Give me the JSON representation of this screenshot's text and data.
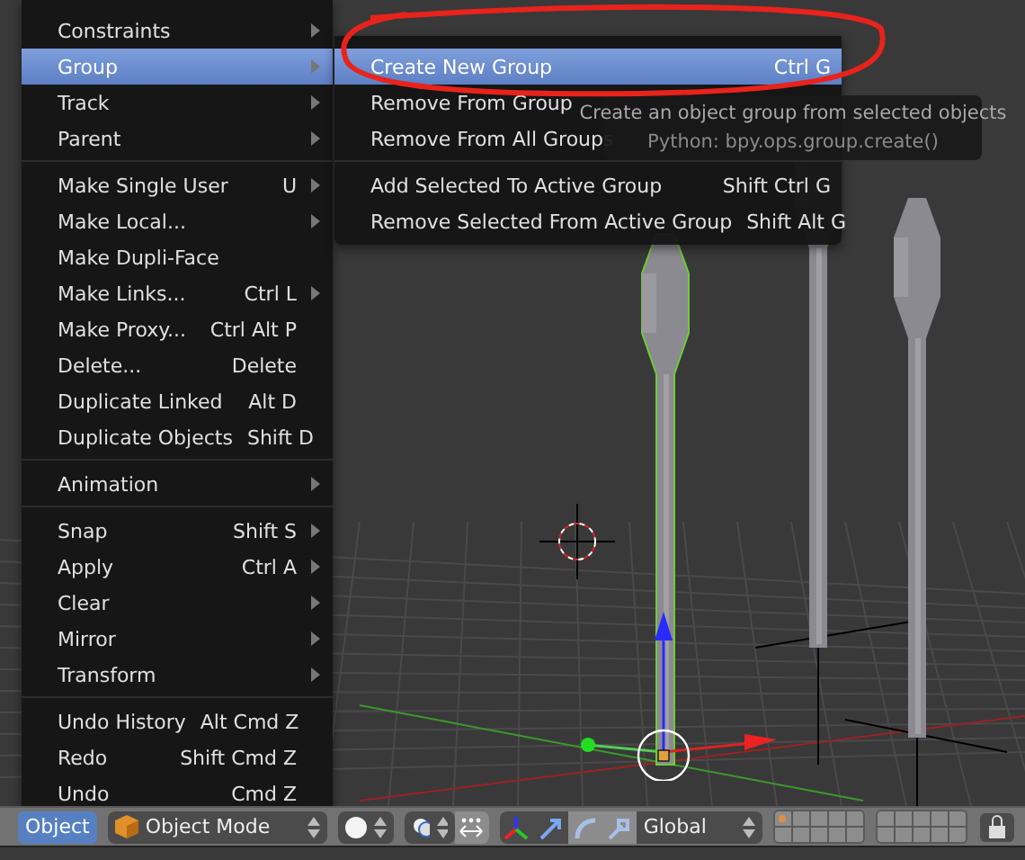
{
  "object_menu": {
    "items": [
      {
        "kind": "item",
        "label": "Constraints",
        "submenu": true,
        "selected": false
      },
      {
        "kind": "item",
        "label": "Group",
        "submenu": true,
        "selected": true
      },
      {
        "kind": "item",
        "label": "Track",
        "submenu": true,
        "selected": false
      },
      {
        "kind": "item",
        "label": "Parent",
        "submenu": true,
        "selected": false
      },
      {
        "kind": "separator"
      },
      {
        "kind": "item",
        "label": "Make Single User",
        "shortcut": "U",
        "submenu": true,
        "selected": false
      },
      {
        "kind": "item",
        "label": "Make Local...",
        "submenu": true,
        "selected": false
      },
      {
        "kind": "item",
        "label": "Make Dupli-Face",
        "submenu": false,
        "selected": false
      },
      {
        "kind": "item",
        "label": "Make Links...",
        "shortcut": "Ctrl L",
        "submenu": true,
        "selected": false
      },
      {
        "kind": "item",
        "label": "Make Proxy...",
        "shortcut": "Ctrl Alt P",
        "submenu": false,
        "selected": false
      },
      {
        "kind": "item",
        "label": "Delete...",
        "shortcut": "Delete",
        "submenu": false,
        "selected": false
      },
      {
        "kind": "item",
        "label": "Duplicate Linked",
        "shortcut": "Alt D",
        "submenu": false,
        "selected": false
      },
      {
        "kind": "item",
        "label": "Duplicate Objects",
        "shortcut": "Shift D",
        "submenu": false,
        "selected": false
      },
      {
        "kind": "separator"
      },
      {
        "kind": "item",
        "label": "Animation",
        "submenu": true,
        "selected": false
      },
      {
        "kind": "separator"
      },
      {
        "kind": "item",
        "label": "Snap",
        "shortcut": "Shift S",
        "submenu": true,
        "selected": false
      },
      {
        "kind": "item",
        "label": "Apply",
        "shortcut": "Ctrl A",
        "submenu": true,
        "selected": false
      },
      {
        "kind": "item",
        "label": "Clear",
        "submenu": true,
        "selected": false
      },
      {
        "kind": "item",
        "label": "Mirror",
        "submenu": true,
        "selected": false
      },
      {
        "kind": "item",
        "label": "Transform",
        "submenu": true,
        "selected": false
      },
      {
        "kind": "separator"
      },
      {
        "kind": "item",
        "label": "Undo History",
        "shortcut": "Alt Cmd Z",
        "submenu": false,
        "selected": false
      },
      {
        "kind": "item",
        "label": "Redo",
        "shortcut": "Shift Cmd Z",
        "submenu": false,
        "selected": false
      },
      {
        "kind": "item",
        "label": "Undo",
        "shortcut": "Cmd Z",
        "submenu": false,
        "selected": false
      }
    ]
  },
  "group_submenu": {
    "items": [
      {
        "kind": "item",
        "label": "Create New Group",
        "shortcut": "Ctrl G",
        "selected": true
      },
      {
        "kind": "item",
        "label": "Remove From Group",
        "selected": false
      },
      {
        "kind": "item",
        "label": "Remove From All Groups",
        "selected": false
      },
      {
        "kind": "separator"
      },
      {
        "kind": "item",
        "label": "Add Selected To Active Group",
        "shortcut": "Shift Ctrl G",
        "selected": false
      },
      {
        "kind": "item",
        "label": "Remove Selected From Active Group",
        "shortcut": "Shift Alt G",
        "selected": false
      }
    ]
  },
  "tooltip": {
    "lines": [
      "Create an object group from selected objects",
      "Python: bpy.ops.group.create()"
    ]
  },
  "header": {
    "menu_button": {
      "label": "Object",
      "selected": true
    },
    "mode_dropdown": {
      "label": "Object Mode"
    },
    "manipulators": [
      {
        "kind": "translate",
        "selected": true
      },
      {
        "kind": "rotate",
        "selected": false
      },
      {
        "kind": "scale",
        "selected": false
      }
    ],
    "orientation_dropdown": {
      "label": "Global"
    },
    "layers": [
      {
        "has_objects": true
      },
      {
        "has_objects": false
      },
      {
        "has_objects": false
      },
      {
        "has_objects": false
      },
      {
        "has_objects": false
      },
      {
        "has_objects": false
      },
      {
        "has_objects": false
      },
      {
        "has_objects": false
      },
      {
        "has_objects": false
      },
      {
        "has_objects": false
      },
      {
        "has_objects": false
      },
      {
        "has_objects": false
      },
      {
        "has_objects": false
      },
      {
        "has_objects": false
      },
      {
        "has_objects": false
      },
      {
        "has_objects": false
      },
      {
        "has_objects": false
      },
      {
        "has_objects": false
      },
      {
        "has_objects": false
      },
      {
        "has_objects": false
      }
    ]
  }
}
